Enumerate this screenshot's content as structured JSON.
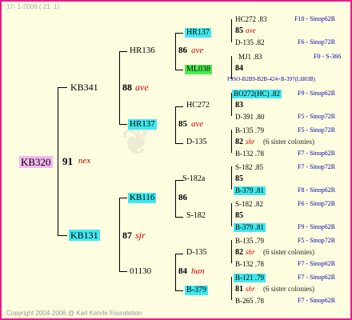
{
  "header": "17- 1-2006 ( 21: 1)",
  "footer": "Copyright 2004-2006 @ Karl Kehrle Foundation",
  "root": {
    "name": "KB320",
    "num": "91",
    "group": "nex"
  },
  "gen2": [
    {
      "name": "KB341",
      "num": "88",
      "group": "ave"
    },
    {
      "name": "KB131",
      "num": "87",
      "group": "sjr"
    }
  ],
  "gen3": [
    {
      "name": "HR136",
      "num": "86",
      "group": "ave"
    },
    {
      "name": "HR137",
      "num": "85",
      "group": "ave"
    },
    {
      "name": "KB116",
      "num": "86",
      "group": ""
    },
    {
      "name": "01130",
      "num": "84",
      "group": "han"
    }
  ],
  "gen4": [
    {
      "name": "HR137",
      "num": "",
      "group": ""
    },
    {
      "name": "ML038",
      "num": "",
      "group": ""
    },
    {
      "name": "HC272",
      "num": "85",
      "group": "ave"
    },
    {
      "name": "D-135",
      "num": "",
      "group": ""
    },
    {
      "name": "S-182a",
      "num": "85",
      "group": ""
    },
    {
      "name": "S-182",
      "num": "",
      "group": ""
    },
    {
      "name": "D-135",
      "num": "82",
      "group": "shr"
    },
    {
      "name": "B-379",
      "num": "",
      "group": ""
    }
  ],
  "gen5": [
    {
      "top": "HC272 .83",
      "top_pedigree": "F10 - Sinop62R",
      "num": "85",
      "group": "ave",
      "bottom": "D-135 .82",
      "bottom_pedigree": "F6 - Sinop72R"
    },
    {
      "top": "MJ1 .83",
      "top_pedigree": "F0 - S-366",
      "num": "84",
      "group": "",
      "bottom": "F9SO-B2B9-B2B-424+B-397(LH83B)",
      "bottom_pedigree": ""
    },
    {
      "top": "BO272(HC) .82",
      "top_pedigree": "F9 - Sinop62R",
      "num": "83",
      "group": "",
      "bottom": "D-391 .80",
      "bottom_pedigree": "F5 - Sinop72R"
    },
    {
      "top": "B-135 .79",
      "top_pedigree": "F5 - Sinop72R",
      "num": "82",
      "group": "shr",
      "sisters": "(6 sister colonies)",
      "bottom": "B-132 .78",
      "bottom_pedigree": "F7 - Sinop62R"
    },
    {
      "top": "S-182 .85",
      "top_pedigree": "F7 - Sinop72R",
      "num": "85",
      "group": "",
      "bottom": "B-379 .81",
      "bottom_pedigree": "F8 - Sinop62R"
    },
    {
      "top": "S-182 .82",
      "top_pedigree": "F6 - Sinop72R",
      "num": "85",
      "group": "",
      "bottom": "B-379 .81",
      "bottom_pedigree": "F9 - Sinop62R"
    },
    {
      "top": "B-135 .79",
      "top_pedigree": "F5 - Sinop72R",
      "num": "82",
      "group": "shr",
      "sisters": "(6 sister colonies)",
      "bottom": "B-132 .78",
      "bottom_pedigree": "F7 - Sinop62R"
    },
    {
      "top": "B-121 .79",
      "top_pedigree": "F7 - Sinop62R",
      "num": "81",
      "group": "shr",
      "sisters": "(6 sister colonies)",
      "bottom": "B-265 .78",
      "bottom_pedigree": "F7 - Sinop62R"
    }
  ]
}
